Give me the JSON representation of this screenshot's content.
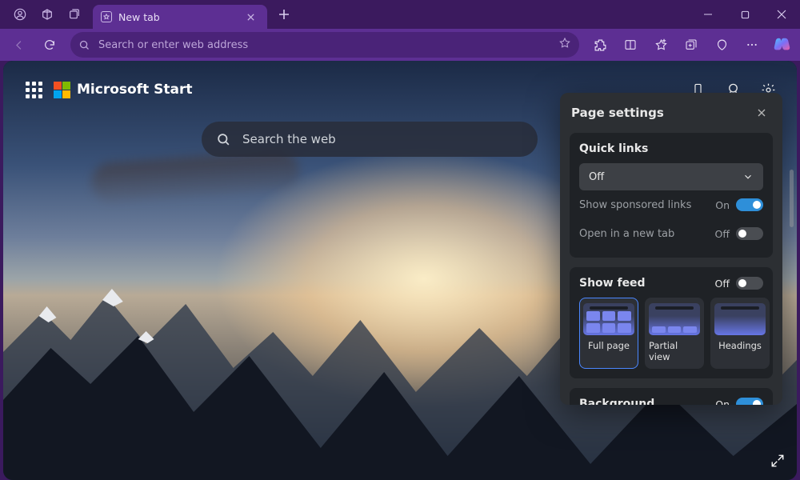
{
  "titlebar": {
    "tab_label": "New tab"
  },
  "toolbar": {
    "address_placeholder": "Search or enter web address"
  },
  "content": {
    "brand": "Microsoft Start",
    "search_placeholder": "Search the web"
  },
  "panel": {
    "title": "Page settings",
    "quick_links": {
      "heading": "Quick links",
      "select_value": "Off",
      "sponsored_label": "Show sponsored links",
      "sponsored_state": "On",
      "newtab_label": "Open in a new tab",
      "newtab_state": "Off"
    },
    "feed": {
      "heading": "Show feed",
      "state": "Off",
      "options": [
        "Full page",
        "Partial view",
        "Headings"
      ]
    },
    "background": {
      "heading": "Background",
      "state": "On"
    }
  },
  "colors": {
    "ms": [
      "#f25022",
      "#7fba00",
      "#00a4ef",
      "#ffb900"
    ]
  }
}
